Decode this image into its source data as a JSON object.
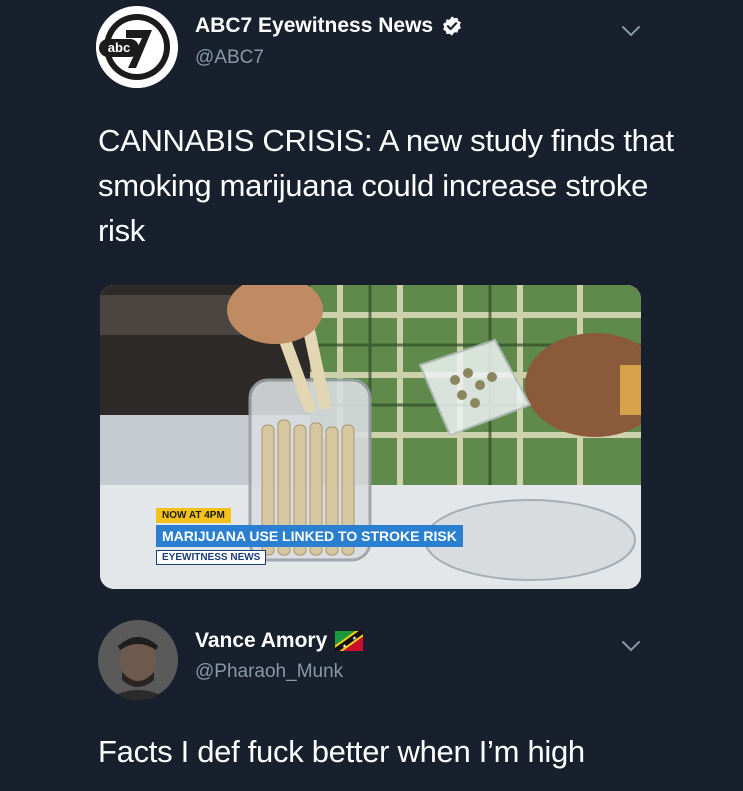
{
  "tweet1": {
    "author": {
      "display_name": "ABC7 Eyewitness News",
      "handle": "@ABC7",
      "verified": true,
      "avatar_logo_text": "abc7"
    },
    "text": "CANNABIS CRISIS: A new study finds that smoking marijuana could increase stroke risk",
    "media": {
      "lower_third": {
        "tag": "NOW AT 4PM",
        "headline": "MARIJUANA USE LINKED TO STROKE RISK",
        "station": "EYEWITNESS NEWS"
      }
    }
  },
  "tweet2": {
    "author": {
      "display_name": "Vance Amory",
      "handle": "@Pharaoh_Munk",
      "flag_icon": "flag-icon"
    },
    "text": "Facts I def fuck better when I’m high"
  },
  "colors": {
    "background": "#17202c",
    "secondary_text": "#8899a6",
    "verified_badge": "#ffffff"
  }
}
